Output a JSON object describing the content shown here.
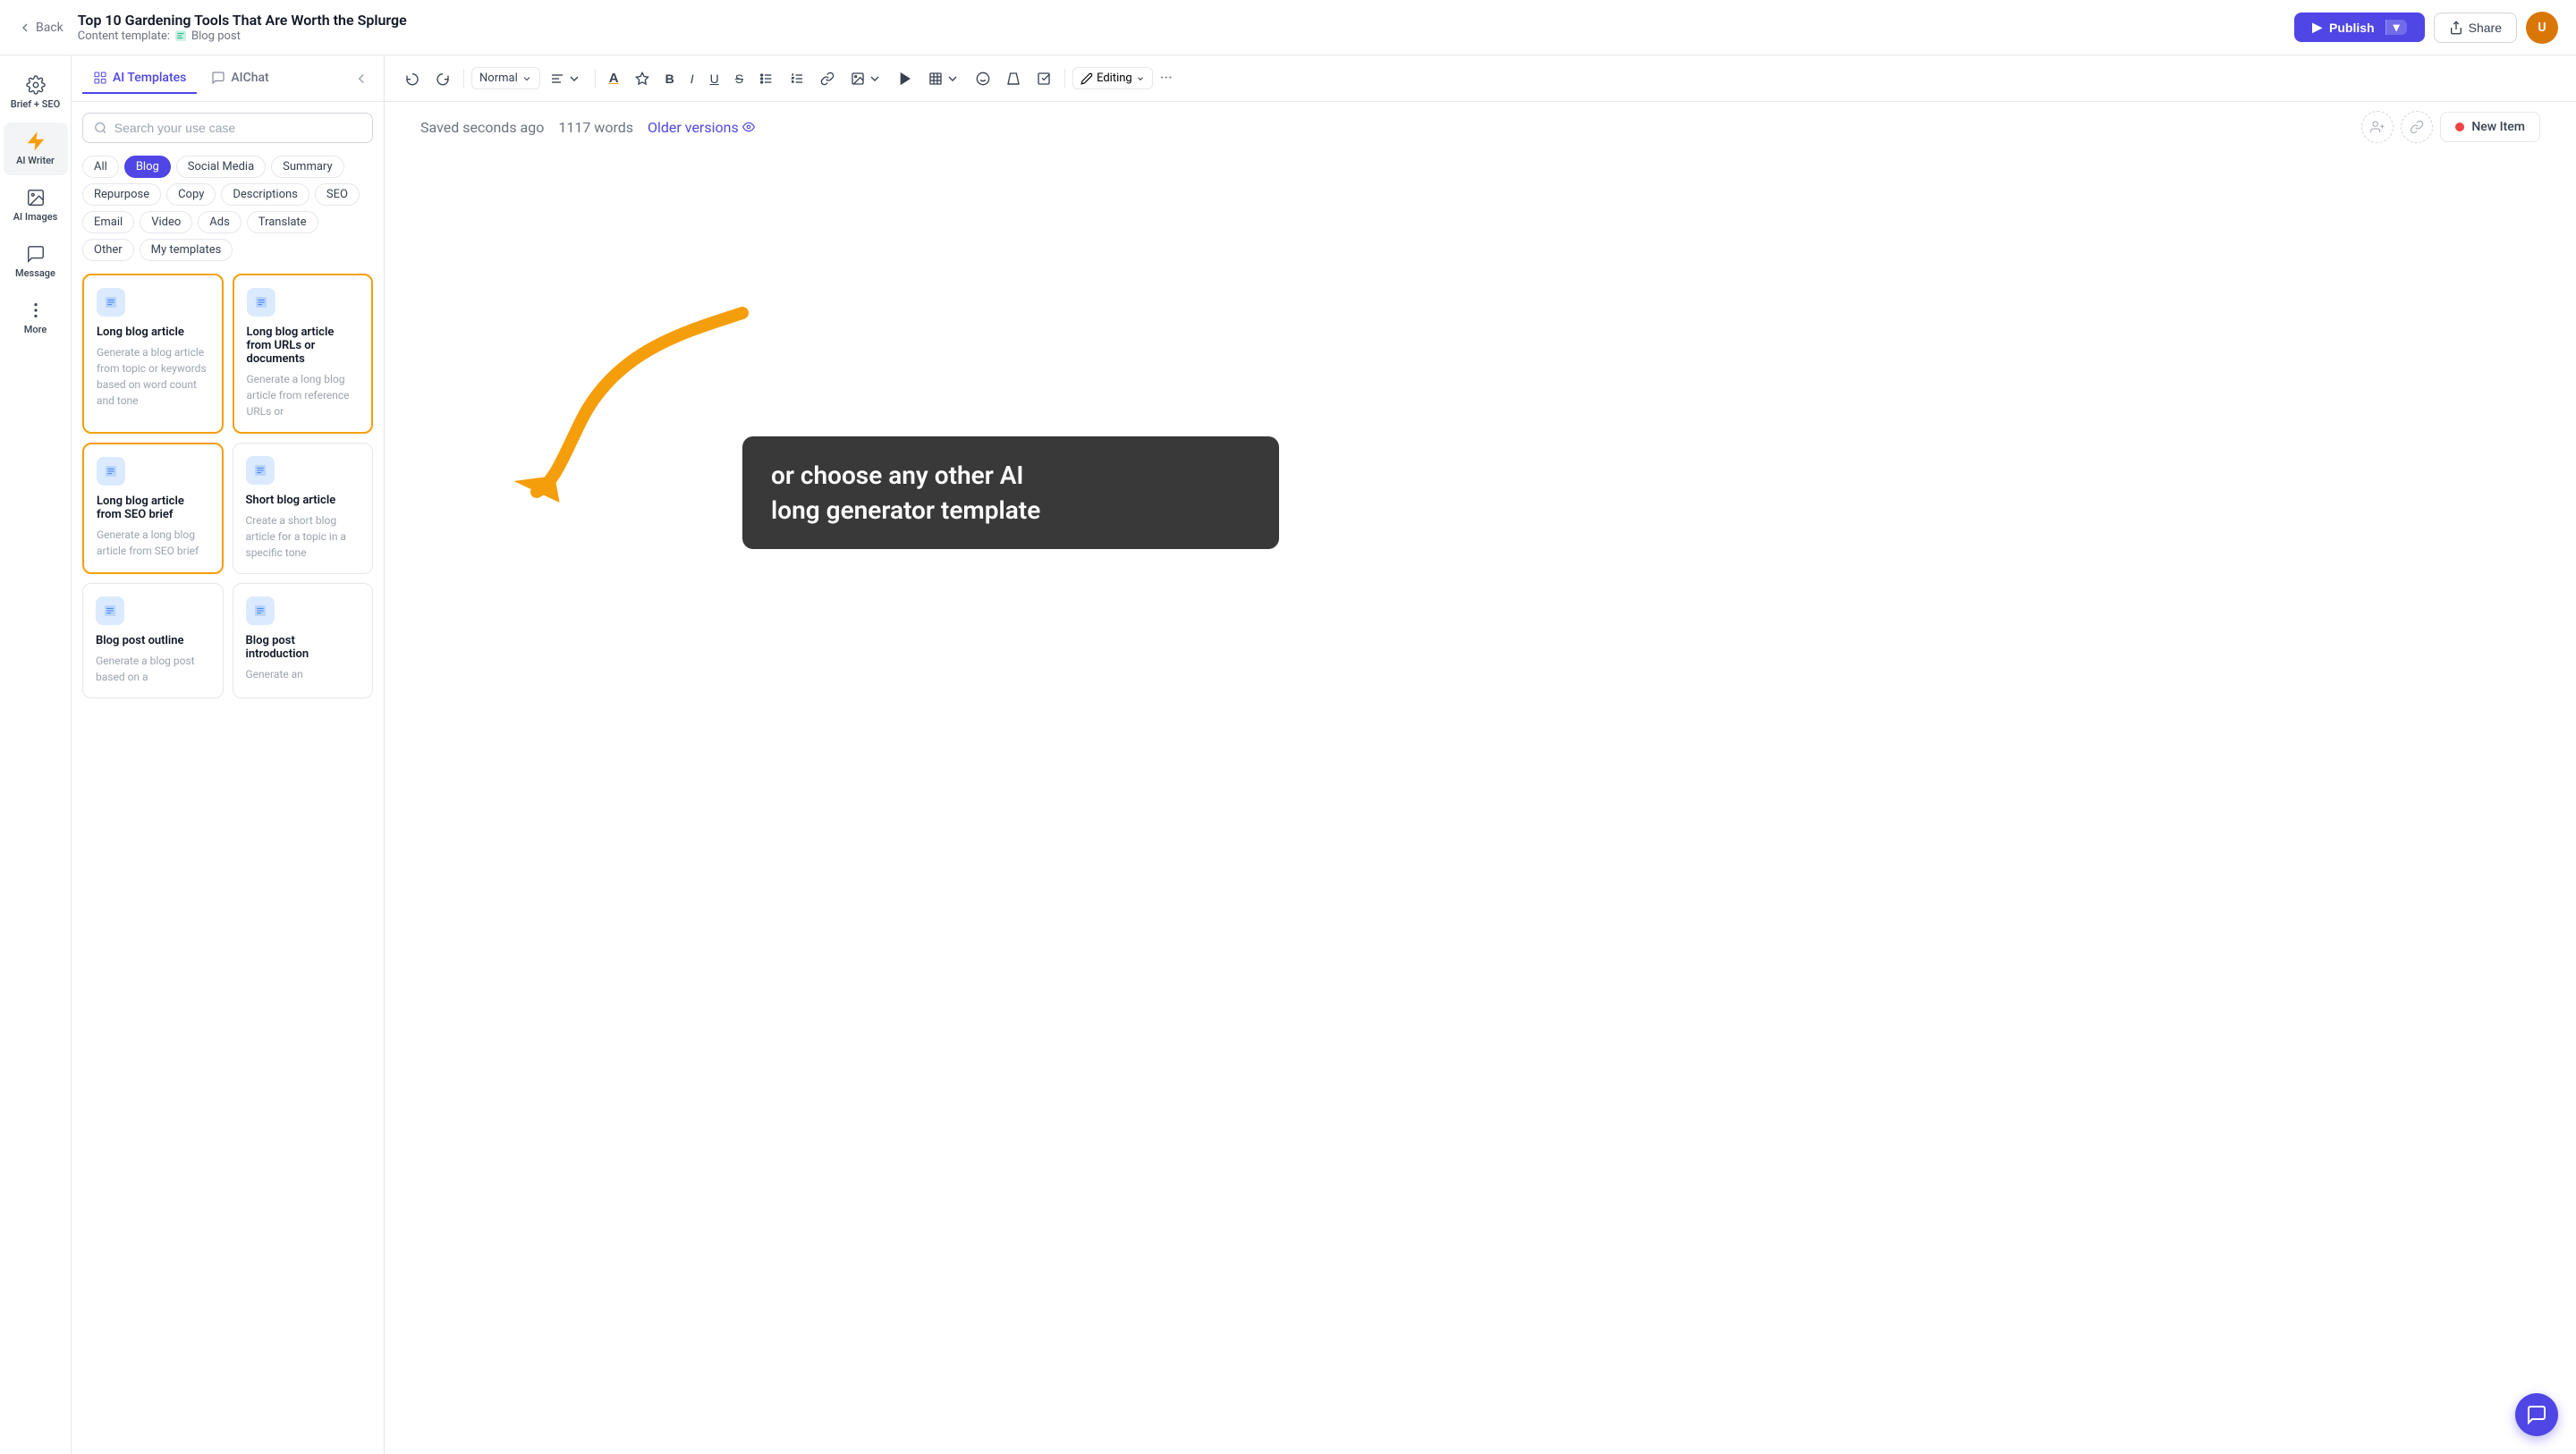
{
  "header": {
    "back_label": "Back",
    "title": "Top 10 Gardening Tools That Are Worth the Splurge",
    "subtitle_prefix": "Content template:",
    "subtitle_link": "Blog post",
    "publish_label": "Publish",
    "share_label": "Share"
  },
  "sidebar": {
    "items": [
      {
        "id": "brief-seo",
        "icon": "gear",
        "label": "Brief + SEO"
      },
      {
        "id": "ai-writer",
        "icon": "lightning",
        "label": "AI Writer"
      },
      {
        "id": "ai-images",
        "icon": "image",
        "label": "AI Images"
      },
      {
        "id": "message",
        "icon": "message",
        "label": "Message"
      },
      {
        "id": "more",
        "icon": "dots",
        "label": "More"
      }
    ]
  },
  "ai_panel": {
    "tabs": [
      {
        "id": "ai-templates",
        "label": "AI Templates",
        "active": true
      },
      {
        "id": "ai-chat",
        "label": "AIChat",
        "active": false
      }
    ],
    "search_placeholder": "Search your use case",
    "filters": [
      {
        "id": "all",
        "label": "All",
        "active": false
      },
      {
        "id": "blog",
        "label": "Blog",
        "active": true
      },
      {
        "id": "social-media",
        "label": "Social Media",
        "active": false
      },
      {
        "id": "summary",
        "label": "Summary",
        "active": false
      },
      {
        "id": "repurpose",
        "label": "Repurpose",
        "active": false
      },
      {
        "id": "copy",
        "label": "Copy",
        "active": false
      },
      {
        "id": "descriptions",
        "label": "Descriptions",
        "active": false
      },
      {
        "id": "seo",
        "label": "SEO",
        "active": false
      },
      {
        "id": "email",
        "label": "Email",
        "active": false
      },
      {
        "id": "video",
        "label": "Video",
        "active": false
      },
      {
        "id": "ads",
        "label": "Ads",
        "active": false
      },
      {
        "id": "translate",
        "label": "Translate",
        "active": false
      },
      {
        "id": "other",
        "label": "Other",
        "active": false
      },
      {
        "id": "my-templates",
        "label": "My templates",
        "active": false
      }
    ],
    "templates": [
      {
        "id": "long-blog-article",
        "title": "Long blog article",
        "description": "Generate a blog article from topic or keywords based on word count and tone",
        "highlighted": true
      },
      {
        "id": "long-blog-urls",
        "title": "Long blog article from URLs or documents",
        "description": "Generate a long blog article from reference URLs or",
        "highlighted": true
      },
      {
        "id": "long-blog-seo",
        "title": "Long blog article from SEO brief",
        "description": "Generate a long blog article from SEO brief",
        "highlighted": true
      },
      {
        "id": "short-blog",
        "title": "Short blog article",
        "description": "Create a short blog article for a topic in a specific tone",
        "highlighted": false
      },
      {
        "id": "blog-post-outline",
        "title": "Blog post outline",
        "description": "Generate a blog post based on a",
        "highlighted": false
      },
      {
        "id": "blog-post-intro",
        "title": "Blog post introduction",
        "description": "Generate an",
        "highlighted": false
      }
    ]
  },
  "editor": {
    "saved_label": "Saved seconds ago",
    "words_label": "1117 words",
    "older_versions_label": "Older versions",
    "format_label": "Normal",
    "editing_label": "Editing",
    "new_item_label": "New Item"
  },
  "overlay": {
    "tooltip_line1": "or choose any other AI",
    "tooltip_line2": "long generator template"
  },
  "chat_bubble": {
    "aria_label": "Open chat"
  }
}
